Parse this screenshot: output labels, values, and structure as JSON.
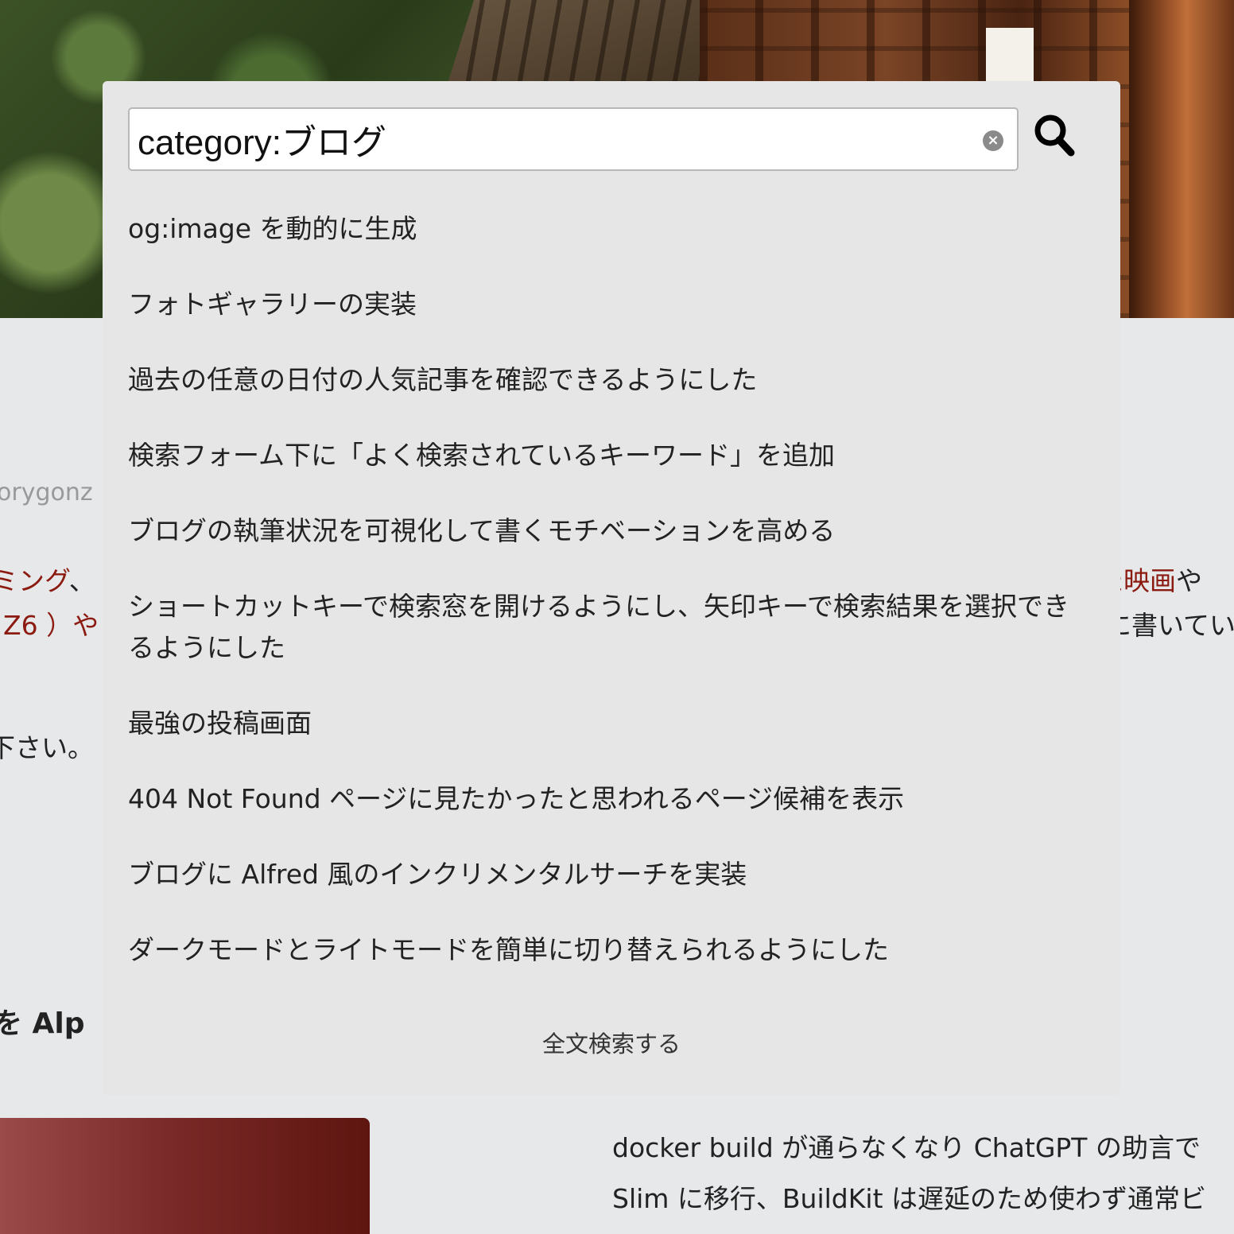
{
  "background": {
    "author_fragment": "orygonz",
    "line1_red_left": "ミング",
    "line1_plain_left": "、",
    "line1_red_right": "た映画",
    "line1_plain_right": "や",
    "line2_red_left": "Z6 ）や",
    "line2_plain_right": "に書いてい",
    "line3_plain_left": "下さい。",
    "heading_fragment": "を Alp",
    "excerpt_lines": [
      "docker build が通らなくなり ChatGPT の助言で",
      "Slim に移行、BuildKit は遅延のため使わず通常ビ"
    ]
  },
  "search": {
    "query": "category:ブログ",
    "clear_glyph": "×",
    "results": [
      "og:image を動的に生成",
      "フォトギャラリーの実装",
      "過去の任意の日付の人気記事を確認できるようにした",
      "検索フォーム下に「よく検索されているキーワード」を追加",
      "ブログの執筆状況を可視化して書くモチベーションを高める",
      "ショートカットキーで検索窓を開けるようにし、矢印キーで検索結果を選択できるようにした",
      "最強の投稿画面",
      "404 Not Found ページに見たかったと思われるページ候補を表示",
      "ブログに Alfred 風のインクリメンタルサーチを実装",
      "ダークモードとライトモードを簡単に切り替えられるようにした"
    ],
    "fulltext_label": "全文検索する"
  },
  "icons": {
    "search": "search-icon",
    "clear": "clear-icon"
  },
  "colors": {
    "modal_bg": "#e6e6e6",
    "page_bg": "#e6e8ea",
    "link_red": "#8b1a10",
    "text": "#222222"
  }
}
